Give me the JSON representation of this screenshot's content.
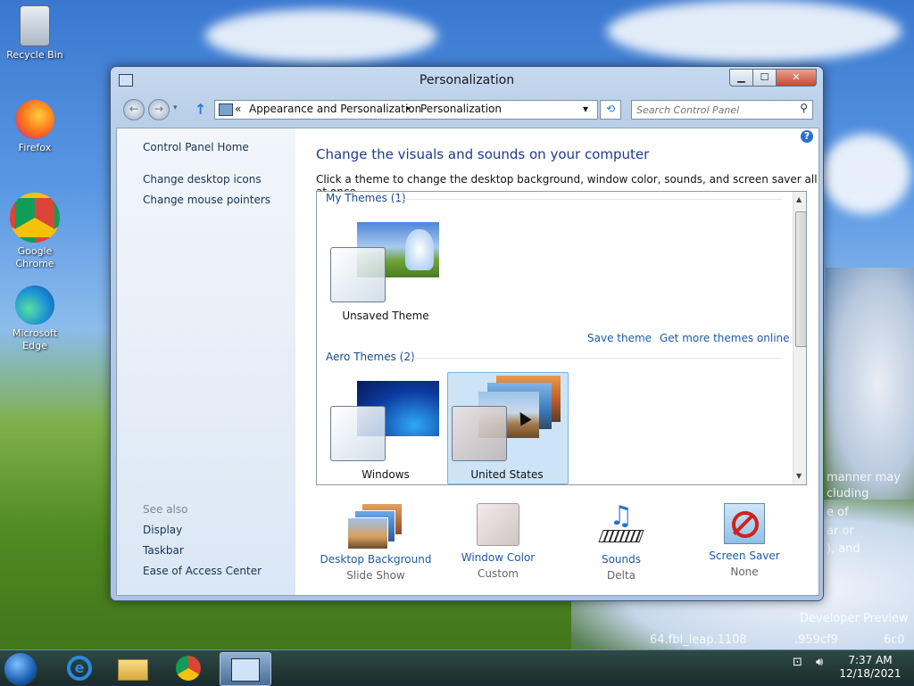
{
  "desktop": {
    "icons": [
      {
        "label": "Recycle Bin"
      },
      {
        "label": "Firefox"
      },
      {
        "label": "Google Chrome"
      },
      {
        "label": "Microsoft Edge"
      }
    ],
    "overlay_text": [
      "manner may",
      "cluding",
      "e of",
      "ar or",
      "), and",
      "Developer Preview",
      "64.fbl_leap.1108",
      ".959cf9",
      "6c0"
    ]
  },
  "window": {
    "title": "Personalization",
    "buttons": {
      "minimize": "▁",
      "maximize": "☐",
      "close": "✕"
    },
    "address": {
      "chevron": "«",
      "crumb1": "Appearance and Personalization",
      "sep": "▸",
      "crumb2": "Personalization",
      "dropdown": "▾"
    },
    "search_placeholder": "Search Control Panel",
    "left_pane": {
      "home": "Control Panel Home",
      "links": [
        "Change desktop icons",
        "Change mouse pointers"
      ],
      "see_also_label": "See also",
      "see_also": [
        "Display",
        "Taskbar",
        "Ease of Access Center"
      ]
    },
    "heading": "Change the visuals and sounds on your computer",
    "description": "Click a theme to change the desktop background, window color, sounds, and screen saver all at once.",
    "my_themes": {
      "label": "My Themes (1)",
      "items": [
        {
          "name": "Unsaved Theme"
        }
      ]
    },
    "theme_links": {
      "save": "Save theme",
      "more": "Get more themes online"
    },
    "aero_themes": {
      "label": "Aero Themes (2)",
      "items": [
        {
          "name": "Windows"
        },
        {
          "name": "United States",
          "selected": true
        }
      ]
    },
    "bottom": [
      {
        "title": "Desktop Background",
        "value": "Slide Show"
      },
      {
        "title": "Window Color",
        "value": "Custom"
      },
      {
        "title": "Sounds",
        "value": "Delta"
      },
      {
        "title": "Screen Saver",
        "value": "None"
      }
    ]
  },
  "taskbar": {
    "time": "7:37 AM",
    "date": "12/18/2021"
  }
}
